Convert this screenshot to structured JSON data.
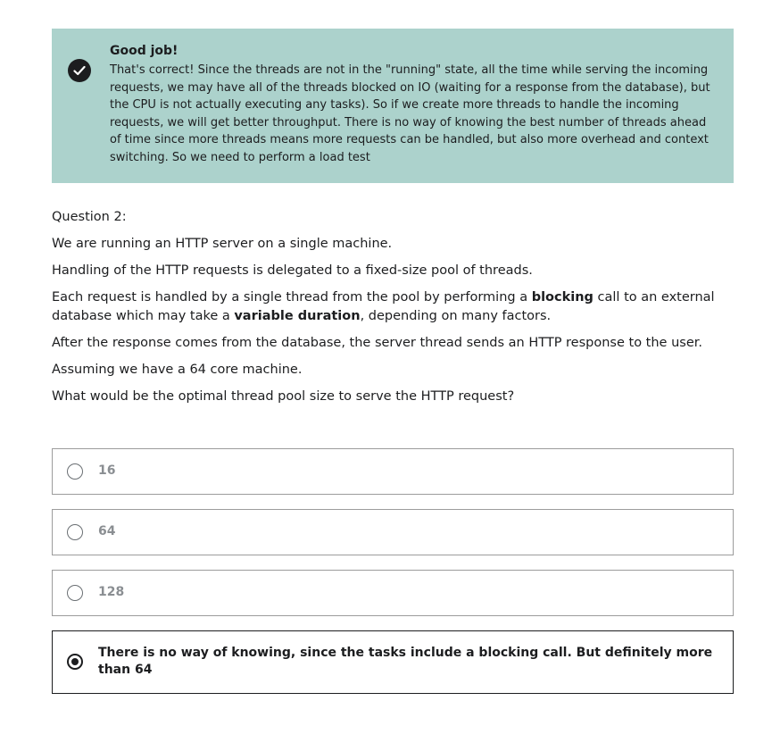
{
  "feedback": {
    "title": "Good job!",
    "text": "That's correct! Since the threads are not in the \"running\" state, all the time while serving the incoming requests, we may have all of the threads blocked on IO (waiting for a response from the database), but the CPU is not actually executing any tasks). So if we create more threads to handle the incoming requests, we will get better throughput. There is no way of knowing the best number of threads ahead of time since more threads means more requests can be handled, but also more overhead and context switching. So we need to perform a load test",
    "icon": "check-circle-icon",
    "background": "#acd2cc"
  },
  "question": {
    "number_label": "Question 2:",
    "line1": "We are running an HTTP server on a single machine.",
    "line2": "Handling  of the HTTP requests is delegated to a fixed-size pool of threads.",
    "line3_a": "Each request is handled by a single thread from the pool by performing a ",
    "line3_bold1": "blocking",
    "line3_b": " call to an external database which may take a ",
    "line3_bold2": "variable duration",
    "line3_c": ", depending on many factors.",
    "line4": "After the response comes from the database, the server thread sends an HTTP response to the user.",
    "line5": "Assuming we have a 64 core machine.",
    "line6": "What would be the optimal thread pool size to serve the HTTP request?"
  },
  "options": [
    {
      "label": "16",
      "selected": false
    },
    {
      "label": "64",
      "selected": false
    },
    {
      "label": "128",
      "selected": false
    },
    {
      "label": "There is no way of knowing, since the tasks include a blocking call. But definitely more than 64",
      "selected": true
    }
  ]
}
